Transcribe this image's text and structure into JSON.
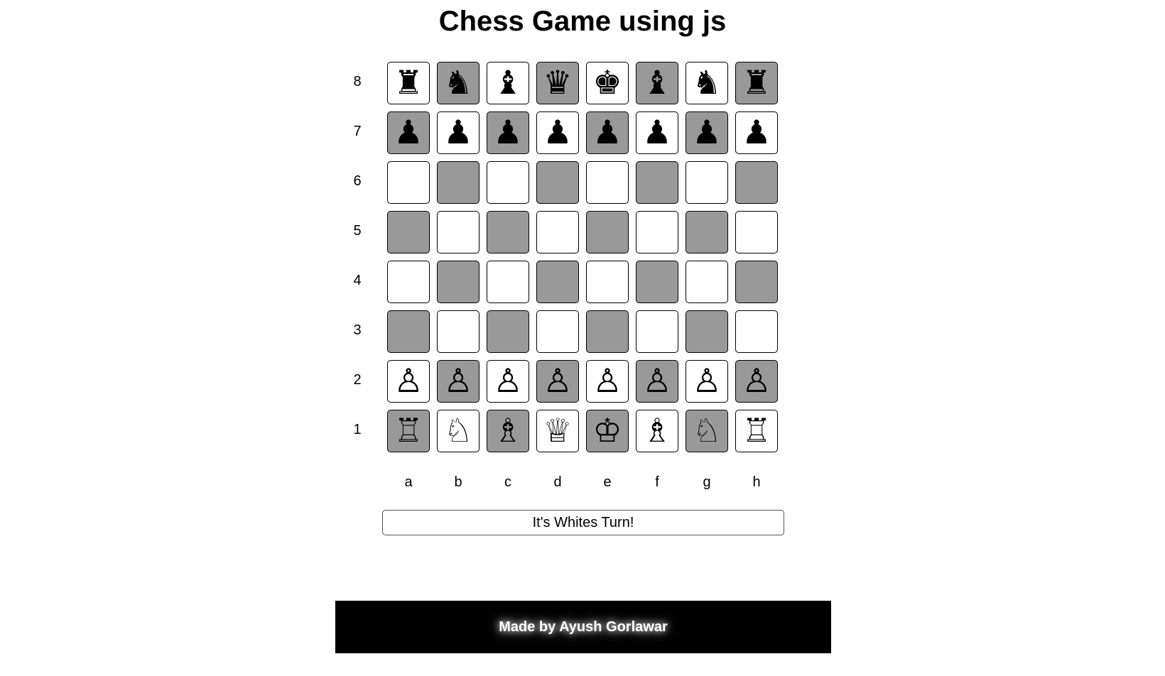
{
  "title": "Chess Game using js",
  "ranks": [
    "8",
    "7",
    "6",
    "5",
    "4",
    "3",
    "2",
    "1"
  ],
  "files": [
    "a",
    "b",
    "c",
    "d",
    "e",
    "f",
    "g",
    "h"
  ],
  "colors": {
    "light_square": "#ffffff",
    "dark_square": "#999999",
    "footer_bg": "#000000",
    "footer_text": "#ffffff"
  },
  "board": [
    [
      "black-rook",
      "black-knight",
      "black-bishop",
      "black-queen",
      "black-king",
      "black-bishop",
      "black-knight",
      "black-rook"
    ],
    [
      "black-pawn",
      "black-pawn",
      "black-pawn",
      "black-pawn",
      "black-pawn",
      "black-pawn",
      "black-pawn",
      "black-pawn"
    ],
    [
      "",
      "",
      "",
      "",
      "",
      "",
      "",
      ""
    ],
    [
      "",
      "",
      "",
      "",
      "",
      "",
      "",
      ""
    ],
    [
      "",
      "",
      "",
      "",
      "",
      "",
      "",
      ""
    ],
    [
      "",
      "",
      "",
      "",
      "",
      "",
      "",
      ""
    ],
    [
      "white-pawn",
      "white-pawn",
      "white-pawn",
      "white-pawn",
      "white-pawn",
      "white-pawn",
      "white-pawn",
      "white-pawn"
    ],
    [
      "white-rook",
      "white-knight",
      "white-bishop",
      "white-queen",
      "white-king",
      "white-bishop",
      "white-knight",
      "white-rook"
    ]
  ],
  "status": "It's Whites Turn!",
  "footer": "Made by Ayush Gorlawar"
}
